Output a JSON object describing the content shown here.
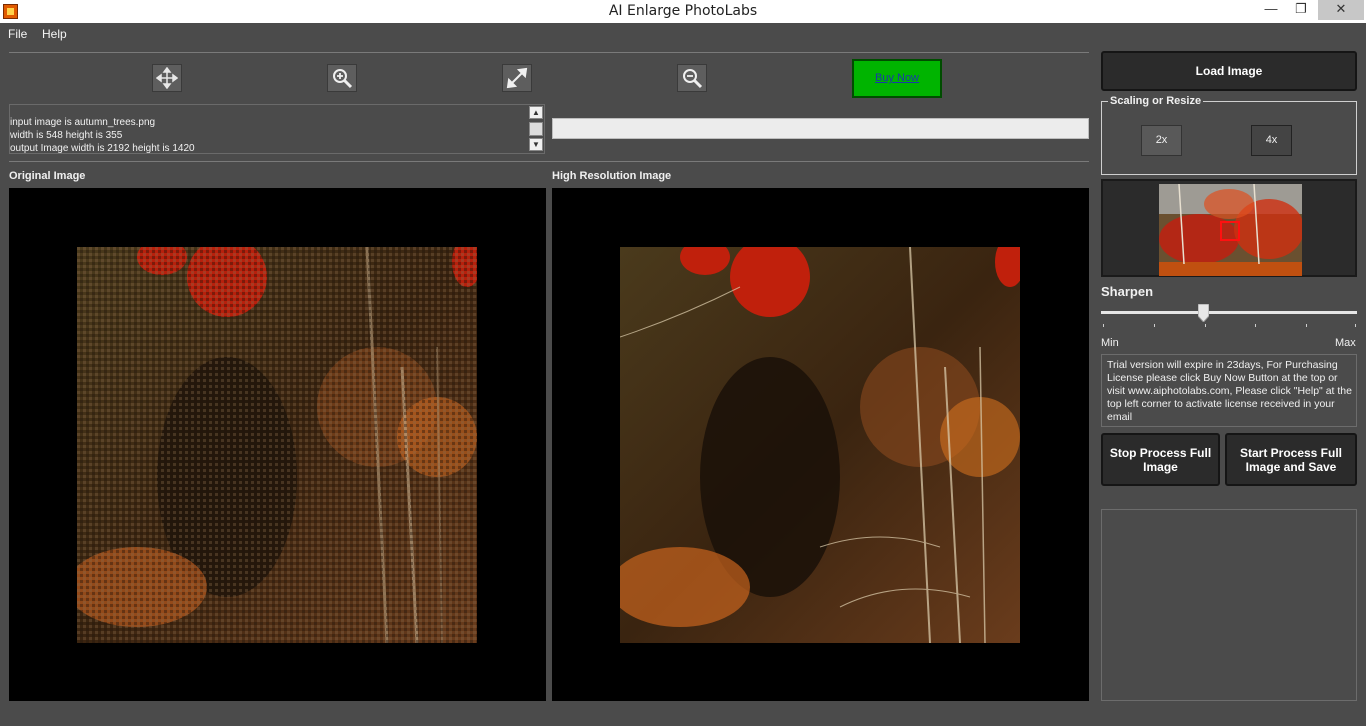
{
  "window": {
    "title": "AI Enlarge PhotoLabs",
    "minimize_icon": "minimize-icon",
    "maximize_icon": "restore-icon",
    "close_icon": "close-icon"
  },
  "menu": {
    "items": [
      "File",
      "Help"
    ]
  },
  "toolbar": {
    "pan_icon": "move-arrows-icon",
    "zoom_in_icon": "zoom-in-icon",
    "fit_icon": "expand-icon",
    "zoom_out_icon": "zoom-out-icon",
    "buy_now_label": "Buy Now",
    "buy_now_color": "#00b400"
  },
  "log": {
    "lines": [
      "input image is autumn_trees.png",
      "width is 548 height is 355",
      "output Image width is 2192 height is 1420"
    ]
  },
  "panes": {
    "original_label": "Original Image",
    "highres_label": "High Resolution Image"
  },
  "right_panel": {
    "load_image_label": "Load Image",
    "scaling_legend": "Scaling or Resize",
    "scale_options": [
      "2x",
      "4x"
    ],
    "selected_scale": "4x",
    "sharpen_label": "Sharpen",
    "sharpen_min": "Min",
    "sharpen_max": "Max",
    "sharpen_level": 0.4,
    "trial_text": "Trial version will expire in 23days, For Purchasing License please click Buy Now Button at the top or visit www.aiphotolabs.com, Please click \"Help\" at the top left corner to activate license received in your email",
    "stop_button_label": "Stop Process Full Image",
    "start_button_label": "Start Process Full Image and Save"
  }
}
